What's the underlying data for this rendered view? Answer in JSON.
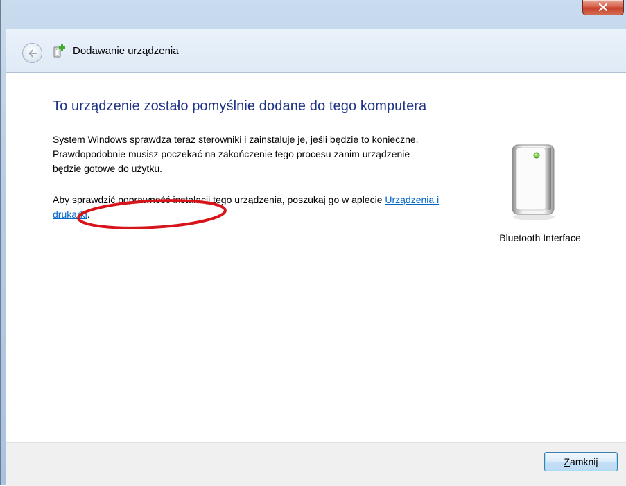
{
  "window": {
    "close_glyph": "x"
  },
  "nav": {
    "title": "Dodawanie urządzenia",
    "back_icon": "back-arrow-icon",
    "wizard_icon": "add-device-icon"
  },
  "main": {
    "heading": "To urządzenie zostało pomyślnie dodane do tego komputera",
    "paragraph1": "System Windows sprawdza teraz sterowniki i zainstaluje je, jeśli będzie to konieczne. Prawdopodobnie musisz poczekać na zakończenie tego procesu zanim urządzenie będzie gotowe do użytku.",
    "paragraph2_prefix": "Aby sprawdzić poprawność instalacji tego urządzenia, poszukaj go w aplecie ",
    "paragraph2_link": "Urządzenia i drukarki",
    "paragraph2_suffix": "."
  },
  "device": {
    "name": "Bluetooth Interface",
    "icon": "bluetooth-device-icon"
  },
  "footer": {
    "close_accesskey": "Z",
    "close_rest": "amknij"
  },
  "colors": {
    "heading": "#1e3287",
    "link": "#0066cc",
    "annotation": "#d7141a"
  }
}
